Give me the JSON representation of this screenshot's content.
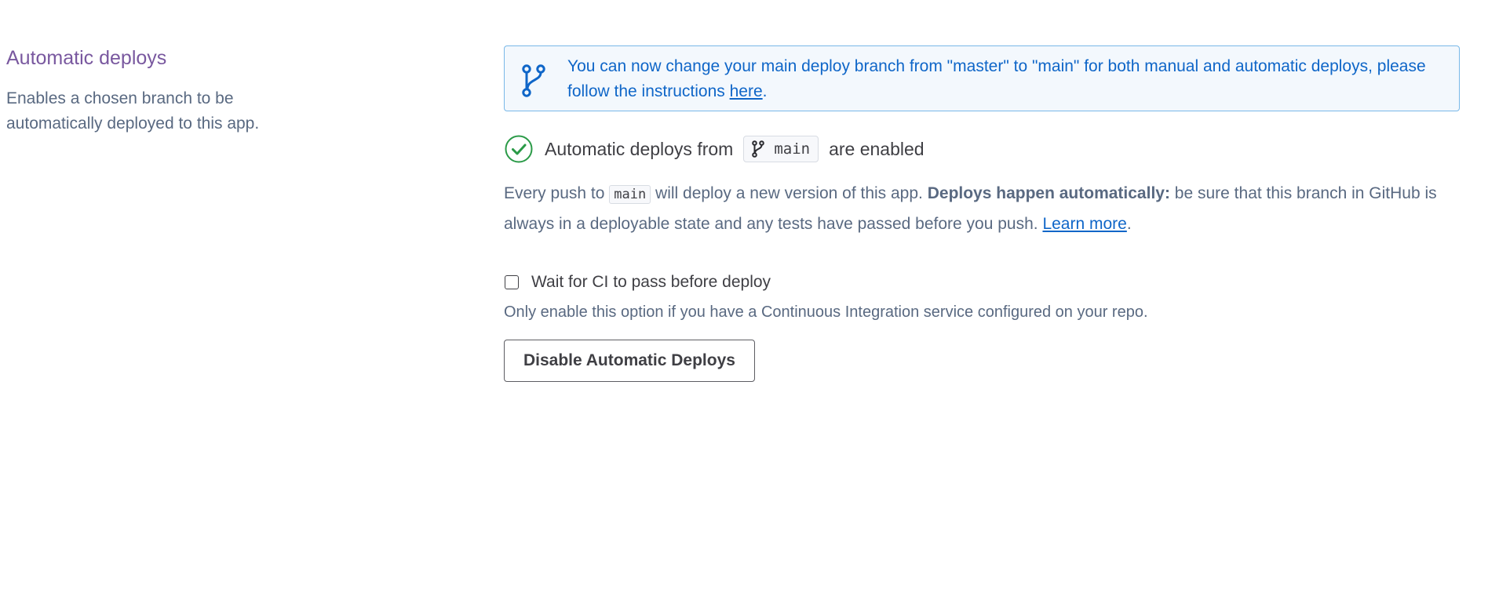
{
  "section": {
    "title": "Automatic deploys",
    "description": "Enables a chosen branch to be automatically deployed to this app."
  },
  "banner": {
    "icon": "git-branch-icon",
    "text_before_link": "You can now change your main deploy branch from \"master\" to \"main\" for both manual and automatic deploys, please follow the instructions ",
    "link_text": "here",
    "text_after_link": ".",
    "color": "#0f66c8"
  },
  "status": {
    "icon": "check-circle-icon",
    "icon_color": "#2a9a47",
    "prefix": "Automatic deploys from",
    "branch_icon": "git-branch-icon",
    "branch": "main",
    "suffix": "are enabled"
  },
  "push_description": {
    "part1": "Every push to ",
    "code": "main",
    "part2": " will deploy a new version of this app. ",
    "bold": "Deploys happen automatically:",
    "part3": " be sure that this branch in GitHub is always in a deployable state and any tests have passed before you push. ",
    "link_text": "Learn more",
    "part4": "."
  },
  "ci": {
    "checkbox_label": "Wait for CI to pass before deploy",
    "checked": false,
    "hint": "Only enable this option if you have a Continuous Integration service configured on your repo."
  },
  "actions": {
    "disable_label": "Disable Automatic Deploys"
  }
}
